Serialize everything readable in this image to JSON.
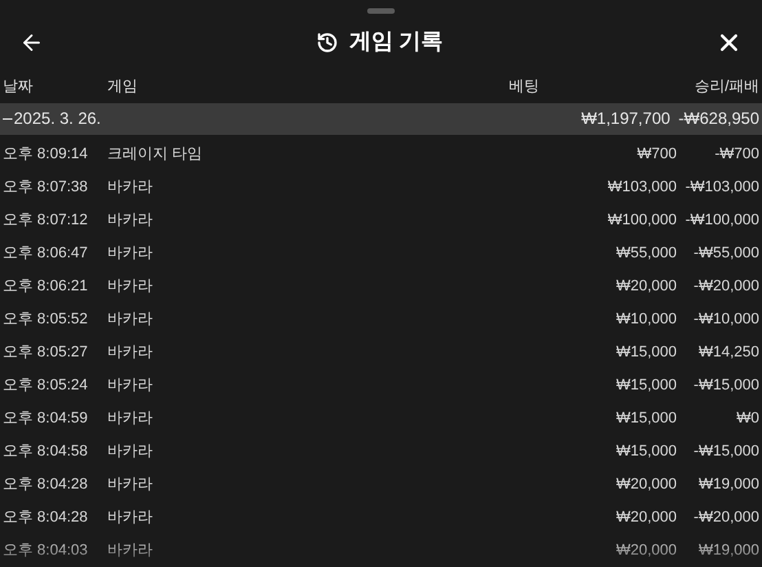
{
  "header": {
    "title": "게임 기록"
  },
  "columns": [
    "날짜",
    "게임",
    "베팅",
    "승리/패배"
  ],
  "group": {
    "date": "2025. 3. 26.",
    "expanded": true,
    "total_bet": "₩1,197,700",
    "total_result": "-₩628,950"
  },
  "rows": [
    {
      "time": "오후 8:09:14",
      "game": "크레이지 타임",
      "bet": "₩700",
      "result": "-₩700"
    },
    {
      "time": "오후 8:07:38",
      "game": "바카라",
      "bet": "₩103,000",
      "result": "-₩103,000"
    },
    {
      "time": "오후 8:07:12",
      "game": "바카라",
      "bet": "₩100,000",
      "result": "-₩100,000"
    },
    {
      "time": "오후 8:06:47",
      "game": "바카라",
      "bet": "₩55,000",
      "result": "-₩55,000"
    },
    {
      "time": "오후 8:06:21",
      "game": "바카라",
      "bet": "₩20,000",
      "result": "-₩20,000"
    },
    {
      "time": "오후 8:05:52",
      "game": "바카라",
      "bet": "₩10,000",
      "result": "-₩10,000"
    },
    {
      "time": "오후 8:05:27",
      "game": "바카라",
      "bet": "₩15,000",
      "result": "₩14,250"
    },
    {
      "time": "오후 8:05:24",
      "game": "바카라",
      "bet": "₩15,000",
      "result": "-₩15,000"
    },
    {
      "time": "오후 8:04:59",
      "game": "바카라",
      "bet": "₩15,000",
      "result": "₩0"
    },
    {
      "time": "오후 8:04:58",
      "game": "바카라",
      "bet": "₩15,000",
      "result": "-₩15,000"
    },
    {
      "time": "오후 8:04:28",
      "game": "바카라",
      "bet": "₩20,000",
      "result": "₩19,000"
    },
    {
      "time": "오후 8:04:28",
      "game": "바카라",
      "bet": "₩20,000",
      "result": "-₩20,000"
    },
    {
      "time": "오후 8:04:03",
      "game": "바카라",
      "bet": "₩20,000",
      "result": "₩19,000"
    }
  ]
}
